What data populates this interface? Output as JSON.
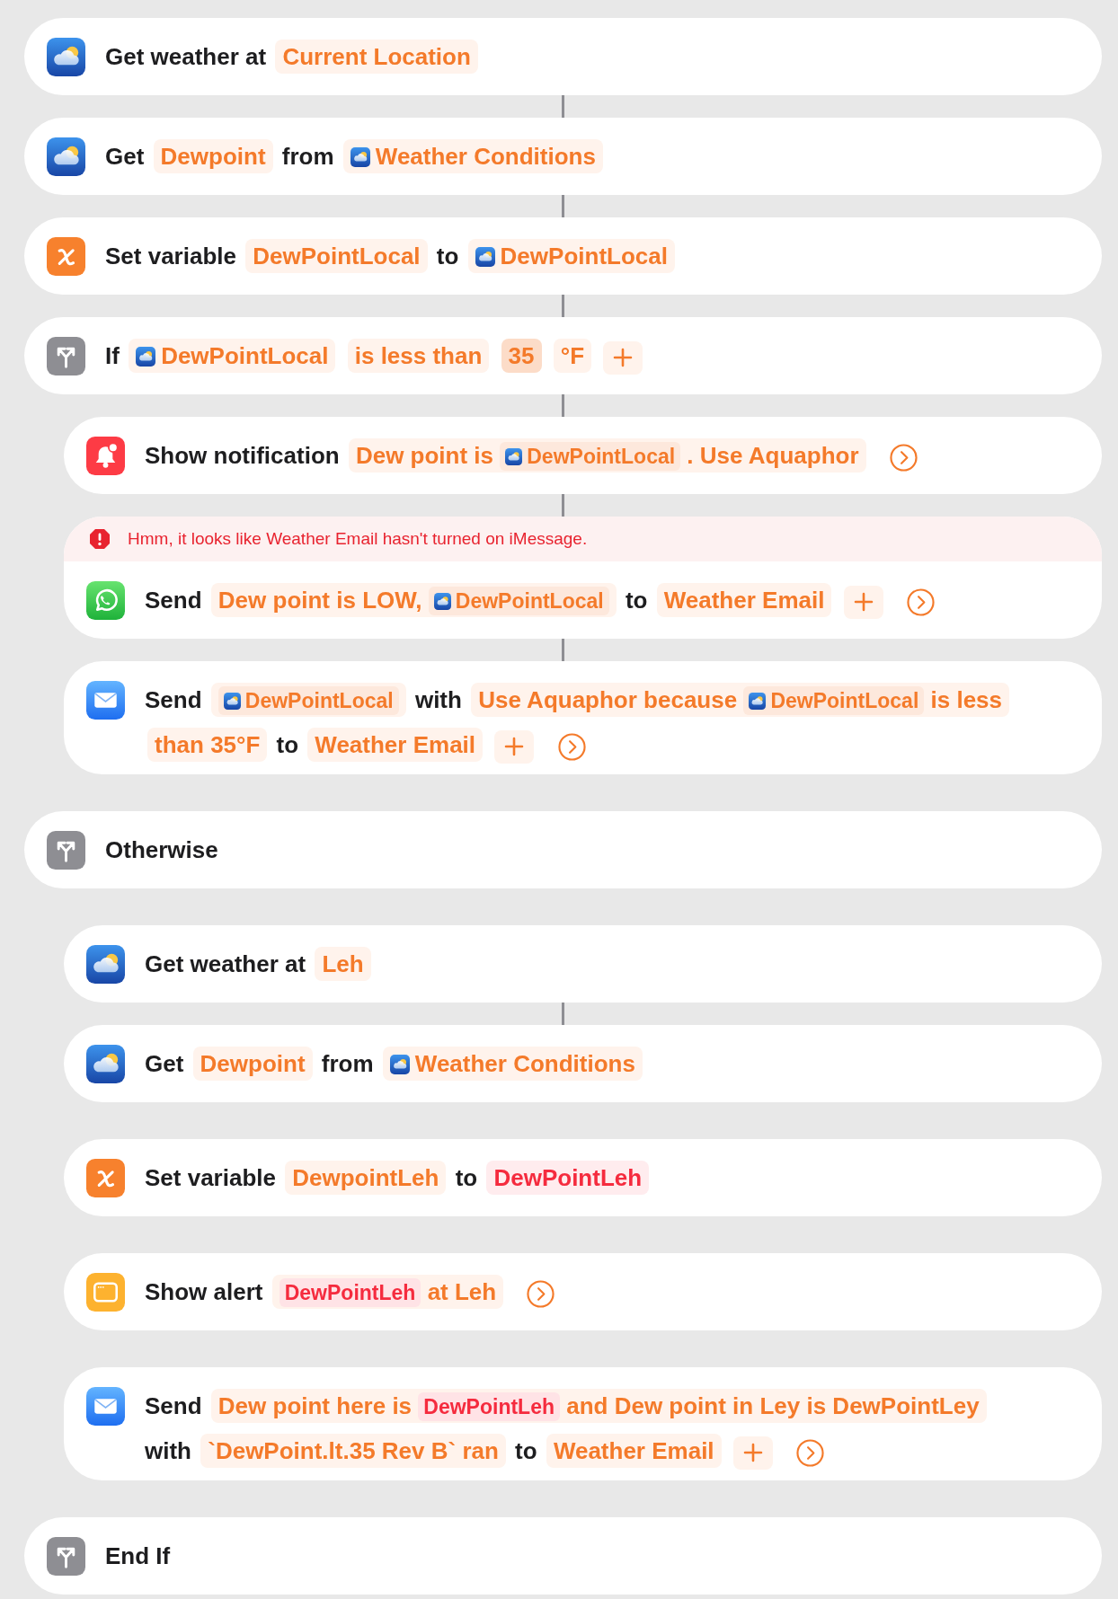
{
  "actions": [
    {
      "kind": "weather",
      "linked": false,
      "tokens": [
        {
          "kind": "label",
          "text": "Get weather at"
        },
        {
          "kind": "param",
          "text": "Current Location"
        }
      ]
    },
    {
      "kind": "weather",
      "linked": true,
      "tokens": [
        {
          "kind": "label",
          "text": "Get"
        },
        {
          "kind": "param",
          "text": "Dewpoint"
        },
        {
          "kind": "label",
          "text": "from"
        },
        {
          "kind": "variable",
          "text": "Weather Conditions"
        }
      ]
    },
    {
      "kind": "variable",
      "linked": true,
      "tokens": [
        {
          "kind": "label",
          "text": "Set variable"
        },
        {
          "kind": "param",
          "text": "DewPointLocal"
        },
        {
          "kind": "label",
          "text": "to"
        },
        {
          "kind": "variable",
          "text": "DewPointLocal"
        }
      ]
    },
    {
      "kind": "condition",
      "linked": true,
      "tokens": [
        {
          "kind": "label",
          "text": "If"
        },
        {
          "kind": "variable",
          "text": "DewPointLocal"
        },
        {
          "kind": "param",
          "text": "is less than"
        },
        {
          "kind": "number",
          "text": "35"
        },
        {
          "kind": "param",
          "text": "°F"
        },
        {
          "kind": "add"
        }
      ],
      "children": [
        {
          "kind": "notification",
          "linked": true,
          "tokens": [
            {
              "kind": "label",
              "text": "Show notification"
            },
            {
              "kind": "param",
              "parts": [
                {
                  "kind": "text",
                  "text": "Dew point is"
                },
                {
                  "kind": "variable",
                  "text": "DewPointLocal"
                },
                {
                  "kind": "text",
                  "text": ". Use Aquaphor"
                }
              ]
            },
            {
              "kind": "more"
            }
          ]
        },
        {
          "kind": "message",
          "linked": true,
          "warning": "Hmm, it looks like Weather Email hasn't turned on iMessage.",
          "tokens": [
            {
              "kind": "label",
              "text": "Send"
            },
            {
              "kind": "param",
              "parts": [
                {
                  "kind": "text",
                  "text": "Dew point is LOW,"
                },
                {
                  "kind": "variable",
                  "text": "DewPointLocal"
                }
              ]
            },
            {
              "kind": "label",
              "text": "to"
            },
            {
              "kind": "param",
              "text": "Weather Email"
            },
            {
              "kind": "add"
            },
            {
              "kind": "more"
            }
          ]
        },
        {
          "kind": "email",
          "linked": true,
          "tokens": [
            {
              "kind": "label",
              "text": "Send"
            },
            {
              "kind": "param",
              "parts": [
                {
                  "kind": "variable",
                  "text": "DewPointLocal"
                }
              ]
            },
            {
              "kind": "label",
              "text": "with"
            },
            {
              "kind": "param",
              "parts": [
                {
                  "kind": "text",
                  "text": "Use Aquaphor because"
                },
                {
                  "kind": "variable",
                  "text": "DewPointLocal"
                },
                {
                  "kind": "text",
                  "text": "is less than 35°F"
                }
              ]
            },
            {
              "kind": "label",
              "text": "to"
            },
            {
              "kind": "param",
              "text": "Weather Email"
            },
            {
              "kind": "add"
            },
            {
              "kind": "more"
            }
          ]
        }
      ]
    },
    {
      "kind": "condition",
      "linked": false,
      "tokens": [
        {
          "kind": "label",
          "text": "Otherwise"
        }
      ],
      "children": [
        {
          "kind": "weather",
          "linked": false,
          "tokens": [
            {
              "kind": "label",
              "text": "Get weather at"
            },
            {
              "kind": "param",
              "text": "Leh"
            }
          ]
        },
        {
          "kind": "weather",
          "linked": true,
          "tokens": [
            {
              "kind": "label",
              "text": "Get"
            },
            {
              "kind": "param",
              "text": "Dewpoint"
            },
            {
              "kind": "label",
              "text": "from"
            },
            {
              "kind": "variable",
              "text": "Weather Conditions"
            }
          ]
        },
        {
          "kind": "variable",
          "linked": false,
          "tokens": [
            {
              "kind": "label",
              "text": "Set variable"
            },
            {
              "kind": "param",
              "text": "DewpointLeh"
            },
            {
              "kind": "label",
              "text": "to"
            },
            {
              "kind": "missing",
              "text": "DewPointLeh"
            }
          ]
        },
        {
          "kind": "alert",
          "linked": false,
          "tokens": [
            {
              "kind": "label",
              "text": "Show alert"
            },
            {
              "kind": "param",
              "parts": [
                {
                  "kind": "missing",
                  "text": "DewPointLeh"
                },
                {
                  "kind": "text",
                  "text": "at Leh"
                }
              ]
            },
            {
              "kind": "more"
            }
          ]
        },
        {
          "kind": "email",
          "linked": false,
          "tokens": [
            {
              "kind": "label",
              "text": "Send"
            },
            {
              "kind": "param",
              "parts": [
                {
                  "kind": "text",
                  "text": "Dew point here is"
                },
                {
                  "kind": "missing",
                  "text": "DewPointLeh"
                },
                {
                  "kind": "text",
                  "text": "and Dew point in Ley is DewPointLey"
                }
              ]
            },
            {
              "kind": "label",
              "text": "with"
            },
            {
              "kind": "param",
              "text": "`DewPoint.lt.35 Rev B` ran"
            },
            {
              "kind": "label",
              "text": "to"
            },
            {
              "kind": "param",
              "text": "Weather Email"
            },
            {
              "kind": "add"
            },
            {
              "kind": "more"
            }
          ]
        }
      ]
    },
    {
      "kind": "condition",
      "linked": false,
      "tokens": [
        {
          "kind": "label",
          "text": "End If"
        }
      ]
    }
  ]
}
